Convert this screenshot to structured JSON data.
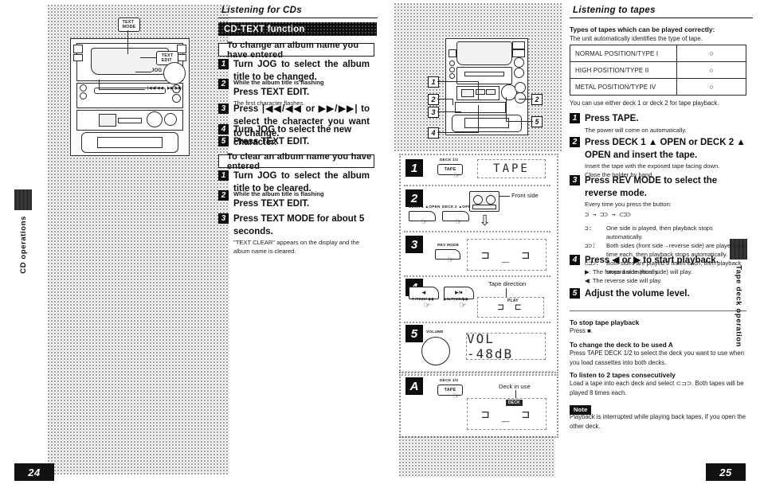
{
  "spread": {
    "left_page_number": "24",
    "right_page_number": "25",
    "left_tab_label": "CD operations",
    "right_tab_label": "Tape deck operation"
  },
  "left_page": {
    "section_title": "Listening for CDs",
    "banner_title": "CD-TEXT function",
    "block_change": {
      "heading": "To change an album name you have entered",
      "steps": [
        {
          "num": "1",
          "pre": "",
          "main": "Turn JOG to select the album title to be changed.",
          "sub": ""
        },
        {
          "num": "2",
          "pre": "While the album title is flashing",
          "main": "Press TEXT EDIT.",
          "sub": "The first character flashes."
        },
        {
          "num": "3",
          "pre": "",
          "main": "Press |◀◀/◀◀ or ▶▶/▶▶| to select the character you want to change.",
          "sub": ""
        },
        {
          "num": "4",
          "pre": "",
          "main": "Turn JOG to select the new character.",
          "sub": ""
        },
        {
          "num": "5",
          "pre": "",
          "main": "Press TEXT EDIT.",
          "sub": ""
        }
      ]
    },
    "block_clear": {
      "heading": "To clear an album name you have entered",
      "steps": [
        {
          "num": "1",
          "pre": "",
          "main": "Turn JOG to select the album title to be cleared.",
          "sub": ""
        },
        {
          "num": "2",
          "pre": "While the album title is flashing",
          "main": "Press TEXT EDIT.",
          "sub": ""
        },
        {
          "num": "3",
          "pre": "",
          "main": "Press TEXT MODE for about 5 seconds.",
          "sub": "\"TEXT CLEAR\" appears on the display and the album name is cleared."
        }
      ]
    },
    "illustration": {
      "callouts": [
        {
          "label": "TEXT MODE"
        },
        {
          "label": "TEXT EDIT"
        },
        {
          "label": "JOG"
        },
        {
          "label": "|◀◀/◀◀   ▶▶/▶▶|"
        }
      ]
    }
  },
  "right_page": {
    "section_title": "Listening to tapes",
    "intro_bold": "Types of tapes which can be played correctly:",
    "intro_sub": "The unit automatically identifies the type of tape.",
    "table": {
      "rows": [
        {
          "type": "NORMAL POSITION/TYPE I",
          "mark": "○"
        },
        {
          "type": "HIGH POSITION/TYPE II",
          "mark": "○"
        },
        {
          "type": "METAL POSITION/TYPE IV",
          "mark": "○"
        }
      ]
    },
    "after_table": "You can use either deck 1 or deck 2 for tape playback.",
    "steps": [
      {
        "num": "1",
        "main": "Press TAPE.",
        "subs": [
          "The power will come on automatically."
        ]
      },
      {
        "num": "2",
        "main": "Press DECK 1 ▲ OPEN or DECK 2 ▲ OPEN and insert the tape.",
        "subs": [
          "Insert the tape with the exposed tape facing down.",
          "Close the holder by hand."
        ]
      },
      {
        "num": "3",
        "main": "Press REV MODE to select the reverse mode.",
        "subs": [
          "Every time you press the button:"
        ],
        "cycle": "⊐ → ⊐⊃ → ⊂⊐⊃",
        "legend": [
          {
            "sym": "⊐:",
            "text": "One side is played, then playback stops automatically."
          },
          {
            "sym": "⊐⊃:",
            "text": "Both sides (front side→reverse side) are played one time each, then playback stops automatically."
          },
          {
            "sym": "⊂⊐⊃:",
            "text": "Both sides are played 8 times each, then playback stops automatically."
          }
        ]
      },
      {
        "num": "4",
        "main": "Press ◀ or ▶ to start playback.",
        "subs": [
          "▶: The forward side (front side) will play.",
          "◀: The reverse side will play."
        ]
      },
      {
        "num": "5",
        "main": "Adjust the volume level.",
        "subs": []
      }
    ],
    "tips": [
      {
        "title": "To stop tape playback",
        "lines": [
          "Press ■."
        ]
      },
      {
        "title": "To change the deck to be used A",
        "lines": [
          "Press TAPE DECK 1/2 to select the deck you want to use when you load cassettes into both decks."
        ]
      },
      {
        "title": "To listen to 2 tapes consecutively",
        "lines": [
          "Load a tape into each deck and select ⊂⊐⊃. Both tapes will be played 8 times each."
        ]
      }
    ],
    "note": {
      "chip": "Note",
      "text": "Playback is interrupted while playing back tapes, if you open the other deck."
    }
  },
  "center_illustration": {
    "unit_markers": [
      "1",
      "2",
      "3",
      "4",
      "2",
      "5"
    ],
    "panels": [
      {
        "badge": "1",
        "button_label": "TAPE",
        "button_caption": "DECK 1/2",
        "display": "TAPE",
        "callouts": []
      },
      {
        "badge": "2",
        "button_label_left": "DECK 1 ▲OPEN",
        "button_label_right": "DECK 2 ▲OPEN",
        "callout": "Front side",
        "display": "",
        "callouts": [
          "Front side"
        ]
      },
      {
        "badge": "3",
        "button_caption": "REV MODE",
        "display": "⊐ _ ⊐",
        "callouts": []
      },
      {
        "badge": "4",
        "button_label_left": "▼/TIME/◀◀",
        "button_label_right": "▶/■/TIME/▶▶",
        "callout": "Tape direction",
        "display": "⊐ ⊏",
        "display_tag": "PLAY",
        "callouts": [
          "Tape direction"
        ]
      },
      {
        "badge": "5",
        "knob_label": "VOLUME",
        "display": "VOL  -48dB",
        "callouts": []
      },
      {
        "badge": "A",
        "button_label": "TAPE",
        "button_caption": "DECK 1/2",
        "callout": "Deck in use",
        "display": "⊐ _ ⊐",
        "display_tag": "DECK",
        "callouts": [
          "Deck in use"
        ]
      }
    ]
  }
}
